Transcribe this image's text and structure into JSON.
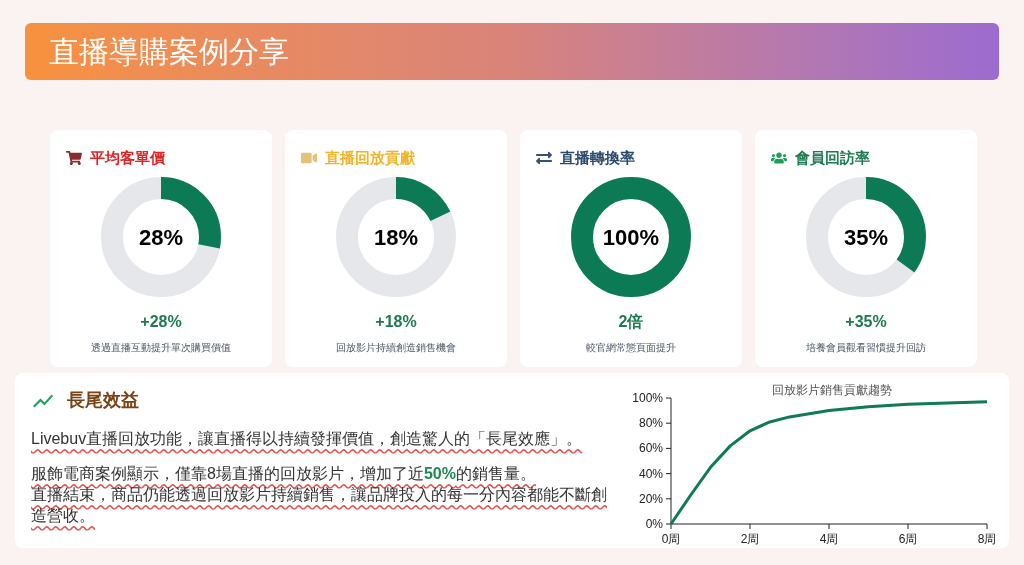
{
  "header": {
    "title": "直播導購案例分享"
  },
  "cards": [
    {
      "kind": "cart",
      "title": "平均客單價",
      "color": "#dc2626",
      "center": "28%",
      "level": 0.28,
      "value": "+28%",
      "caption": "透過直播互動提升單次購買價值"
    },
    {
      "kind": "video",
      "title": "直播回放貢獻",
      "color": "#f0b429",
      "center": "18%",
      "level": 0.18,
      "value": "+18%",
      "caption": "回放影片持續創造銷售機會"
    },
    {
      "kind": "exchange",
      "title": "直播轉換率",
      "color": "#2c4a6e",
      "center": "100%",
      "level": 1,
      "value": "2倍",
      "caption": "較官網常態頁面提升"
    },
    {
      "kind": "users",
      "title": "會員回訪率",
      "color": "#1e7a4f",
      "center": "35%",
      "level": 0.35,
      "value": "+35%",
      "caption": "培養會員觀看習慣提升回訪"
    }
  ],
  "long_tail": {
    "title": "長尾效益",
    "paragraphs": [
      [
        "Livebuv直播回放功能，讓直播得以持續發揮價值，創造驚人的「長尾效應」。"
      ],
      [
        "服飾電商案例顯示，僅靠8場直播的回放影片，增加了近**50%**的銷售量。",
        "直播結束，商品仍能透過回放影片持續銷售，讓品牌投入的每一分內容都能不斷創造營收。"
      ]
    ],
    "chart_data": {
      "type": "line",
      "title": "回放影片銷售貢獻趨勢",
      "x": [
        0,
        0.5,
        1,
        1.5,
        2,
        2.5,
        3,
        4,
        5,
        6,
        7,
        8
      ],
      "series": [
        {
          "color": "#0f7a55",
          "values": [
            0,
            23,
            45,
            62,
            74,
            81,
            85,
            90,
            93,
            95,
            96,
            97
          ]
        }
      ],
      "xlim": [
        0,
        8
      ],
      "ylim": [
        0,
        100
      ],
      "xticks": [
        {
          "value": 0,
          "label": "0周"
        },
        {
          "value": 2,
          "label": "2周"
        },
        {
          "value": 4,
          "label": "4周"
        },
        {
          "value": 6,
          "label": "6周"
        },
        {
          "value": 8,
          "label": "8周"
        }
      ],
      "yticks": [
        {
          "value": 0,
          "label": "0%"
        },
        {
          "value": 20,
          "label": "20%"
        },
        {
          "value": 40,
          "label": "40%"
        },
        {
          "value": 60,
          "label": "60%"
        },
        {
          "value": 80,
          "label": "80%"
        },
        {
          "value": 100,
          "label": "100%"
        }
      ]
    }
  }
}
